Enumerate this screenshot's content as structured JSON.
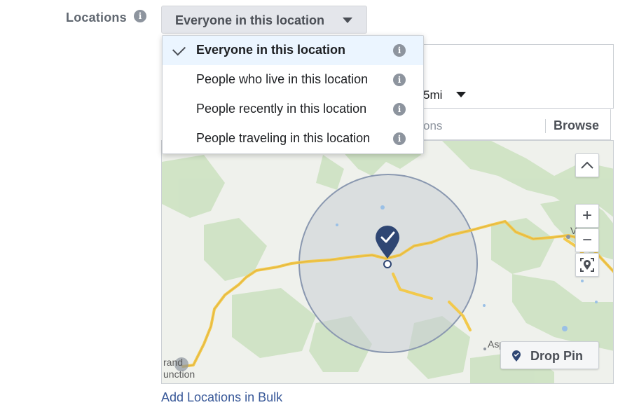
{
  "locations": {
    "label": "Locations",
    "info_icon": "info-icon"
  },
  "audience_select": {
    "selected_label": "Everyone in this location"
  },
  "audience_menu": {
    "items": [
      {
        "label": "Everyone in this location",
        "selected": true
      },
      {
        "label": "People who live in this location",
        "selected": false
      },
      {
        "label": "People recently in this location",
        "selected": false
      },
      {
        "label": "People traveling in this location",
        "selected": false
      }
    ]
  },
  "location_box": {
    "radius_partial": "5mi"
  },
  "search": {
    "placeholder_partial": "ons",
    "browse_label": "Browse"
  },
  "map": {
    "place_labels": [
      "Asp",
      "rand",
      "unction",
      "V"
    ],
    "zoom_in": "+",
    "zoom_out": "−",
    "drop_pin_label": "Drop Pin",
    "colors": {
      "radius_fill": "#c9ced6",
      "radius_stroke": "#8a98b0",
      "road": "#f2c94c",
      "pin": "#2f4673",
      "forest": "#cfe3c4"
    }
  },
  "footer": {
    "bulk_link": "Add Locations in Bulk"
  }
}
